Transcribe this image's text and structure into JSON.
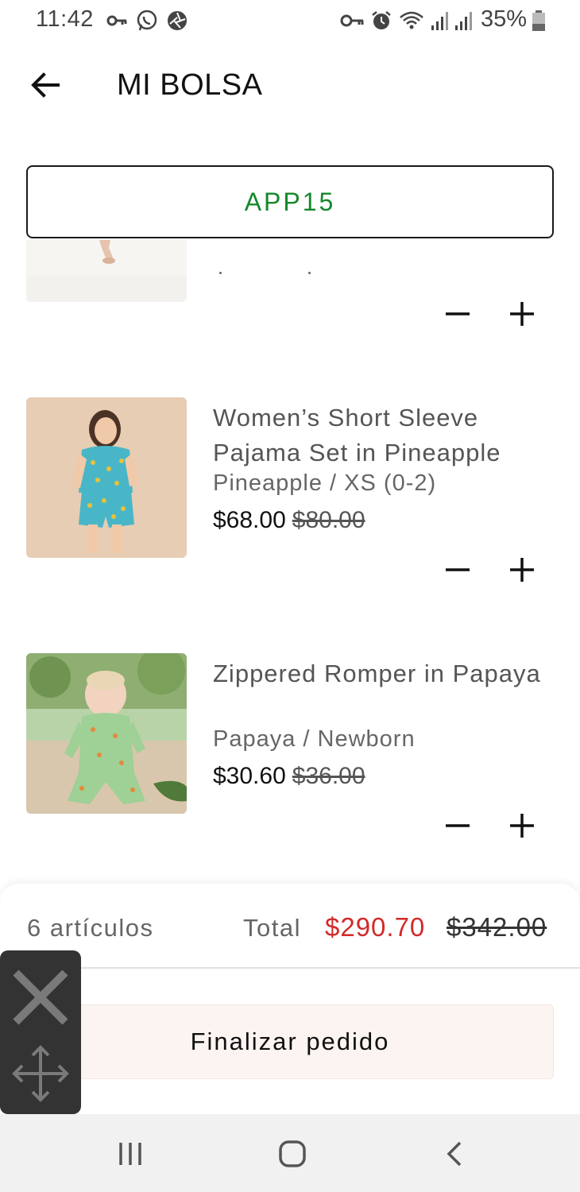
{
  "status_bar": {
    "time": "11:42",
    "battery": "35%",
    "icons": [
      "key-icon",
      "whatsapp-icon",
      "shutter-icon",
      "vpn-key-icon",
      "alarm-icon",
      "wifi-icon",
      "signal-icon",
      "signal-icon",
      "battery-icon"
    ]
  },
  "header": {
    "title": "MI BOLSA",
    "back_icon": "arrow-left-icon"
  },
  "coupon": {
    "code": "APP15",
    "color": "#16882a"
  },
  "items": [
    {
      "name": "Women’s Short Sleeve Pajama Set in Pineapple",
      "variant": "Pineapple / XS (0-2)",
      "price": "$68.00",
      "original_price": "$80.00"
    },
    {
      "name": "Zippered Romper in Papaya",
      "variant": "Papaya / Newborn",
      "price": "$30.60",
      "original_price": "$36.00"
    }
  ],
  "quantity_controls": {
    "decrease_icon": "minus-icon",
    "increase_icon": "plus-icon"
  },
  "summary": {
    "items_count": "6 artículos",
    "total_label": "Total",
    "total": "$290.70",
    "total_original": "$342.00",
    "total_color": "#d22a2a"
  },
  "checkout": {
    "label": "Finalizar pedido"
  },
  "overlay": {
    "close_icon": "close-icon",
    "move_icon": "move-icon"
  },
  "nav_bar": {
    "icons": [
      "recent-apps-icon",
      "home-icon",
      "back-chevron-icon"
    ]
  }
}
